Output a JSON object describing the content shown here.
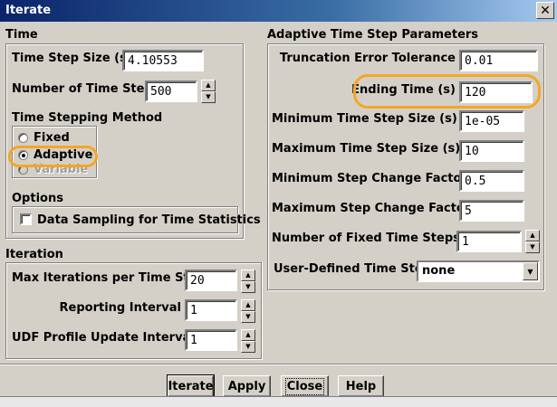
{
  "window": {
    "title": "Iterate",
    "close_glyph": "✕"
  },
  "time": {
    "title": "Time",
    "step_size_label": "Time Step Size (s)",
    "step_size_value": "4.10553",
    "num_steps_label": "Number of Time Steps",
    "num_steps_value": "500",
    "method_title": "Time Stepping Method",
    "methods": [
      {
        "label": "Fixed",
        "selected": false,
        "enabled": true
      },
      {
        "label": "Adaptive",
        "selected": true,
        "enabled": true
      },
      {
        "label": "Variable",
        "selected": false,
        "enabled": false
      }
    ],
    "options_title": "Options",
    "data_sampling_label": "Data Sampling for Time Statistics",
    "data_sampling_checked": false
  },
  "iteration": {
    "title": "Iteration",
    "max_iter_label": "Max Iterations per Time Step",
    "max_iter_value": "20",
    "reporting_label": "Reporting Interval",
    "reporting_value": "1",
    "udf_label": "UDF Profile Update Interval",
    "udf_value": "1"
  },
  "adaptive": {
    "title": "Adaptive Time Step Parameters",
    "truncation_label": "Truncation Error Tolerance",
    "truncation_value": "0.01",
    "ending_label": "Ending Time (s)",
    "ending_value": "120",
    "min_step_label": "Minimum Time Step Size (s)",
    "min_step_value": "1e-05",
    "max_step_label": "Maximum Time Step Size (s)",
    "max_step_value": "10",
    "min_factor_label": "Minimum Step Change Factor",
    "min_factor_value": "0.5",
    "max_factor_label": "Maximum Step Change Factor",
    "max_factor_value": "5",
    "fixed_steps_label": "Number of Fixed Time Steps",
    "fixed_steps_value": "1",
    "udf_step_label": "User-Defined Time Step",
    "udf_step_value": "none"
  },
  "buttons": {
    "iterate": "Iterate",
    "apply": "Apply",
    "close": "Close",
    "help": "Help"
  },
  "colors": {
    "highlight": "#f5a623",
    "dialog_bg": "#d4d0c8",
    "title_bar": "#0a246a"
  },
  "icons": {
    "spin_up": "▲",
    "spin_down": "▼",
    "dropdown": "▼"
  }
}
